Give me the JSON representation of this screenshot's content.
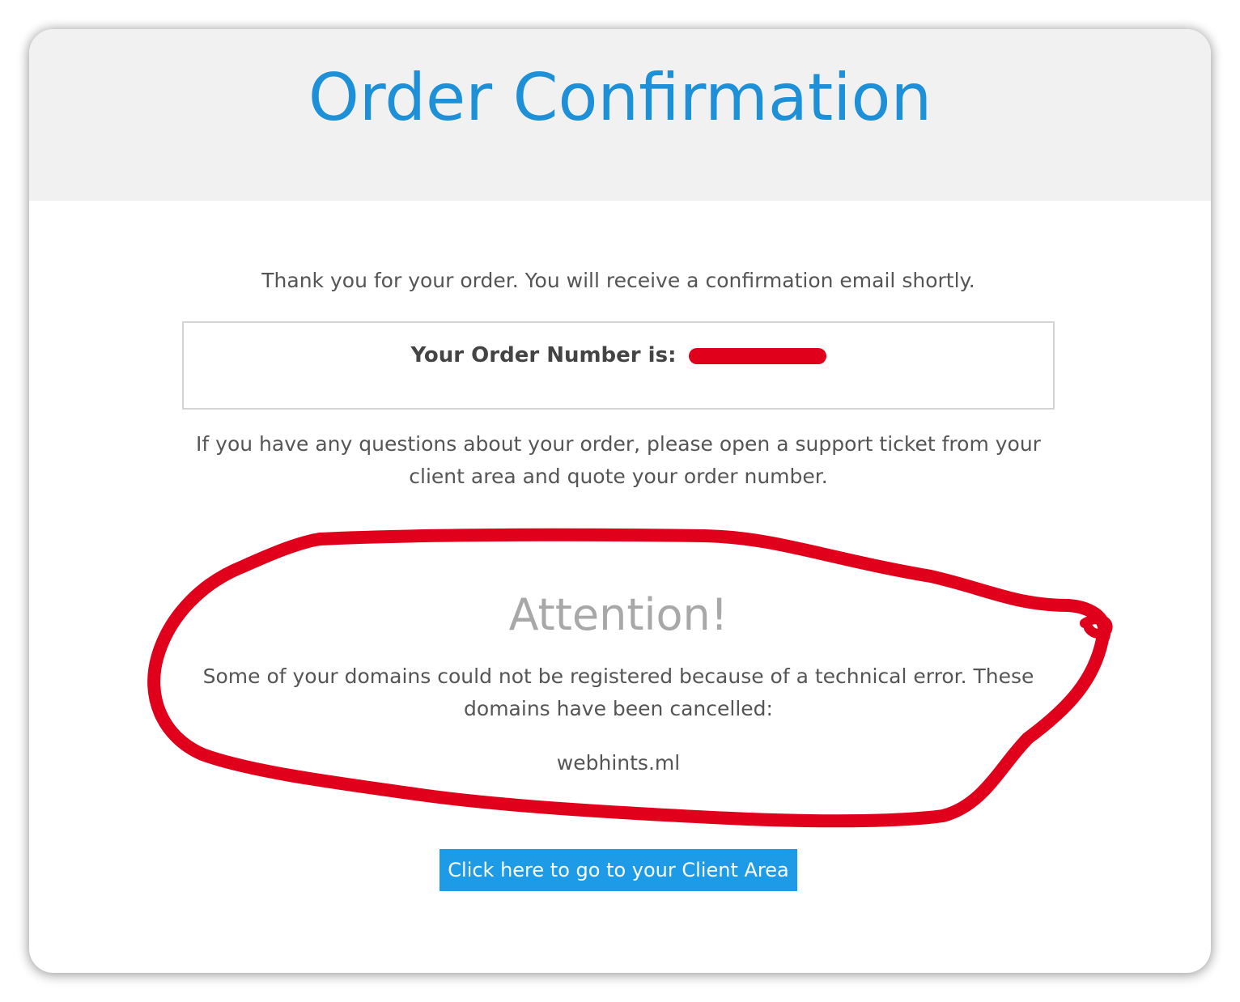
{
  "header": {
    "title": "Order Confirmation"
  },
  "main": {
    "thanks_message": "Thank you for your order. You will receive a confirmation email shortly.",
    "order_number_label": "Your Order Number is:",
    "questions_message": "If you have any questions about your order, please open a support ticket from your client area and quote your order number."
  },
  "attention": {
    "title": "Attention!",
    "message": "Some of your domains could not be registered because of a technical error. These domains have been cancelled:",
    "domains": [
      "webhints.ml"
    ]
  },
  "actions": {
    "client_area_label": "Click here to go to your Client Area"
  },
  "colors": {
    "accent": "#1e90d8",
    "button": "#1e9be6",
    "header_bg": "#f1f1f1",
    "annotation": "#e0001b"
  }
}
